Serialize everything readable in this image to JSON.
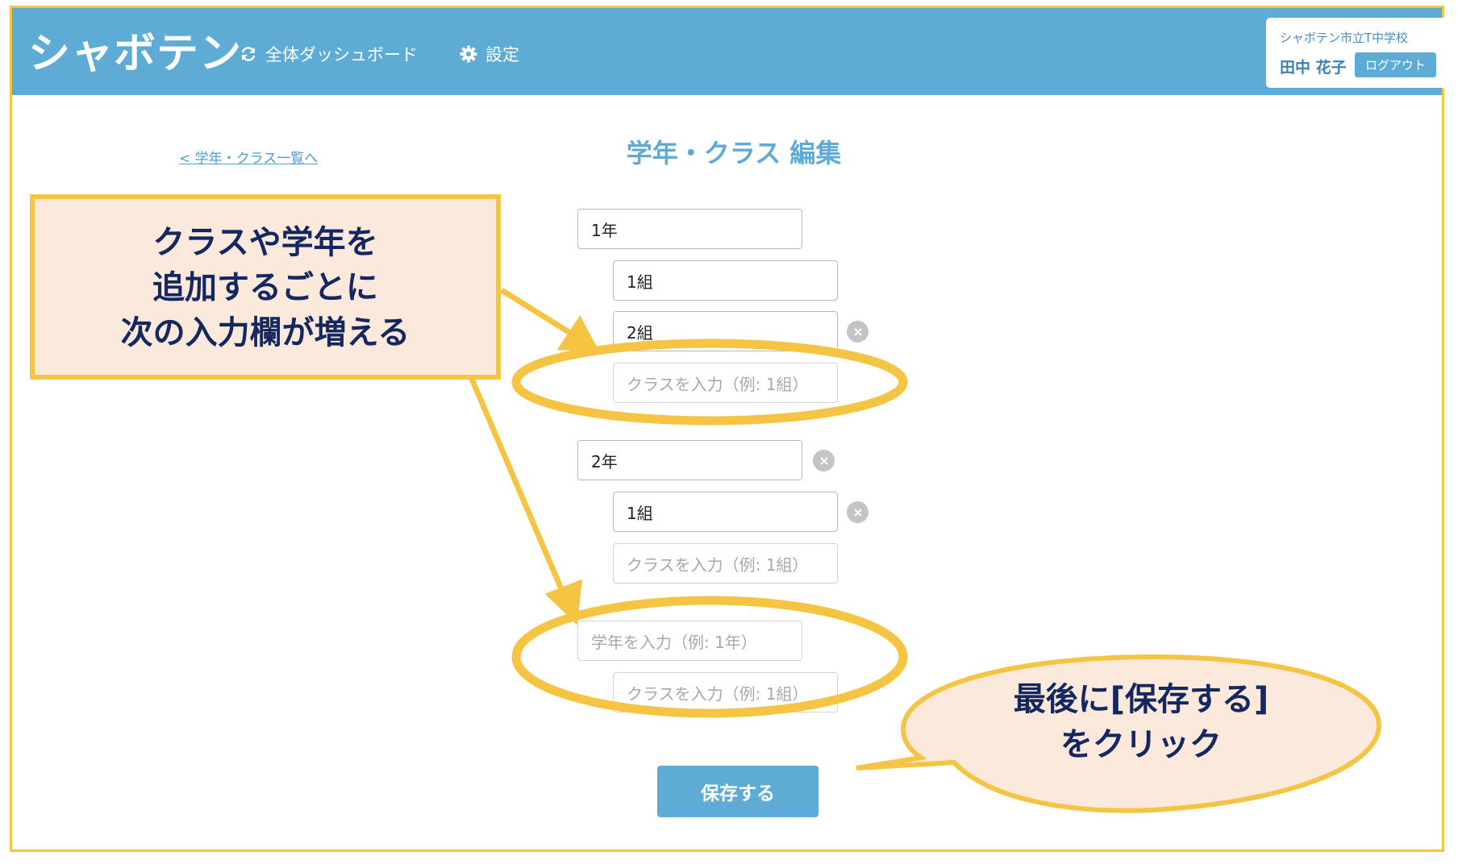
{
  "app": {
    "logo": "シャボテン",
    "nav": [
      {
        "label": "全体ダッシュボード",
        "icon": "refresh-icon"
      },
      {
        "label": "設定",
        "icon": "gear-icon"
      }
    ],
    "user": {
      "school": "シャボテン市立T中学校",
      "name": "田中 花子",
      "logout_label": "ログアウト"
    }
  },
  "page": {
    "back_link": "< 学年・クラス一覧へ",
    "title": "学年・クラス 編集"
  },
  "form": {
    "grade_placeholder": "学年を入力（例: 1年）",
    "class_placeholder": "クラスを入力（例: 1組）",
    "grades": [
      {
        "value": "1年",
        "classes": [
          "1組",
          "2組"
        ]
      },
      {
        "value": "2年",
        "classes": [
          "1組"
        ]
      }
    ],
    "save_label": "保存する"
  },
  "annotations": {
    "callout1": [
      "クラスや学年を",
      "追加するごとに",
      "次の入力欄が増える"
    ],
    "callout2": [
      "最後に[保存する]",
      "をクリック"
    ],
    "highlight_color": "#f5c443",
    "callout_bg": "#fbeadb",
    "text_color": "#142760"
  },
  "colors": {
    "primary": "#5eacd6",
    "frame": "#f5c443"
  }
}
